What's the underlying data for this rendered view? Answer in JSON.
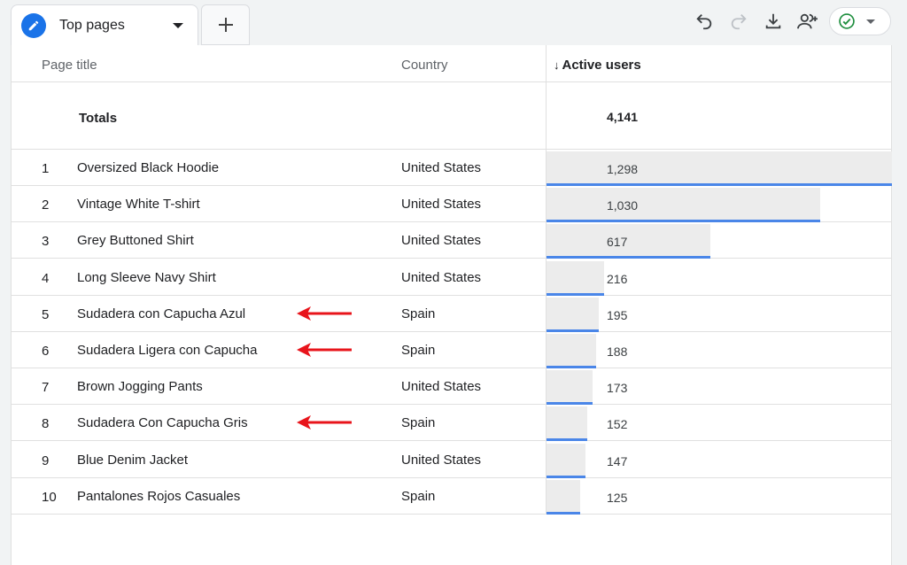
{
  "tab": {
    "label": "Top pages",
    "add_symbol": "+"
  },
  "toolbar": {
    "icons": [
      "undo-icon",
      "redo-icon",
      "download-icon",
      "share-icon",
      "check-circle-icon"
    ],
    "accent": "#1a73e8",
    "status_color": "#1e8e3e"
  },
  "table": {
    "headers": {
      "page_title": "Page title",
      "country": "Country",
      "active_users": "Active users",
      "sort_arrow": "↓"
    },
    "totals": {
      "label": "Totals",
      "value": "4,141"
    },
    "bar_color": "#4a86e8",
    "rows": [
      {
        "num": "1",
        "title": "Oversized Black Hoodie",
        "country": "United States",
        "value": "1,298",
        "users": 1298,
        "arrow": false
      },
      {
        "num": "2",
        "title": "Vintage White T-shirt",
        "country": "United States",
        "value": "1,030",
        "users": 1030,
        "arrow": false
      },
      {
        "num": "3",
        "title": "Grey Buttoned Shirt",
        "country": "United States",
        "value": "617",
        "users": 617,
        "arrow": false
      },
      {
        "num": "4",
        "title": "Long Sleeve Navy Shirt",
        "country": "United States",
        "value": "216",
        "users": 216,
        "arrow": false
      },
      {
        "num": "5",
        "title": "Sudadera con Capucha Azul",
        "country": "Spain",
        "value": "195",
        "users": 195,
        "arrow": true
      },
      {
        "num": "6",
        "title": "Sudadera Ligera con Capucha",
        "country": "Spain",
        "value": "188",
        "users": 188,
        "arrow": true
      },
      {
        "num": "7",
        "title": "Brown Jogging Pants",
        "country": "United States",
        "value": "173",
        "users": 173,
        "arrow": false
      },
      {
        "num": "8",
        "title": "Sudadera Con Capucha Gris",
        "country": "Spain",
        "value": "152",
        "users": 152,
        "arrow": true
      },
      {
        "num": "9",
        "title": "Blue Denim Jacket",
        "country": "United States",
        "value": "147",
        "users": 147,
        "arrow": false
      },
      {
        "num": "10",
        "title": "Pantalones Rojos Casuales",
        "country": "Spain",
        "value": "125",
        "users": 125,
        "arrow": false
      }
    ]
  }
}
